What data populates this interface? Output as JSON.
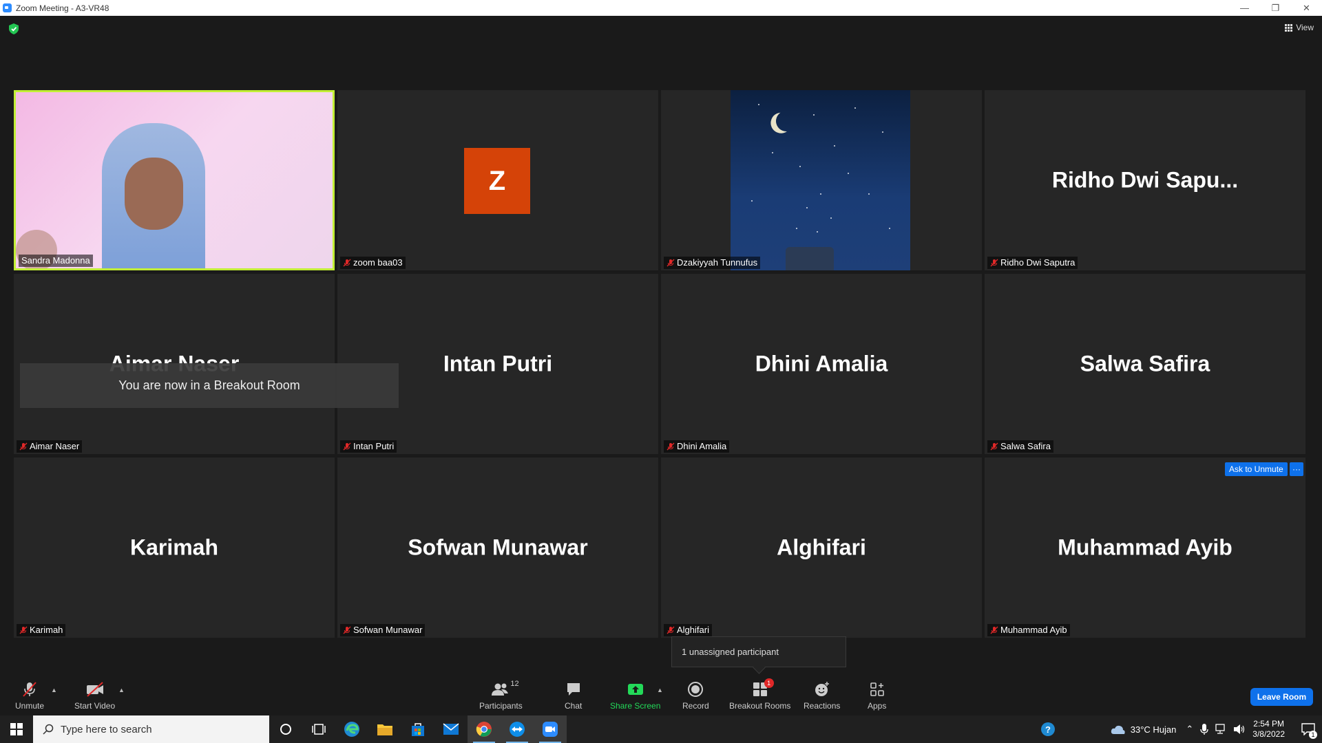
{
  "window": {
    "title": "Zoom Meeting - A3-VR48"
  },
  "top": {
    "view_label": "View"
  },
  "toast": {
    "text": "You are now in a Breakout Room"
  },
  "tiles": [
    {
      "big_name": "",
      "label": "Sandra Madonna",
      "muted": false,
      "type": "video"
    },
    {
      "big_name": "",
      "label": "zoom baa03",
      "muted": true,
      "type": "avatar",
      "avatar_letter": "Z",
      "avatar_color": "#d54308"
    },
    {
      "big_name": "",
      "label": "Dzakiyyah Tunnufus",
      "muted": true,
      "type": "image"
    },
    {
      "big_name": "Ridho Dwi Sapu...",
      "label": "Ridho Dwi Saputra",
      "muted": true,
      "type": "name"
    },
    {
      "big_name": "Aimar Naser",
      "label": "Aimar Naser",
      "muted": true,
      "type": "name"
    },
    {
      "big_name": "Intan Putri",
      "label": "Intan Putri",
      "muted": true,
      "type": "name"
    },
    {
      "big_name": "Dhini Amalia",
      "label": "Dhini Amalia",
      "muted": true,
      "type": "name"
    },
    {
      "big_name": "Salwa Safira",
      "label": "Salwa Safira",
      "muted": true,
      "type": "name"
    },
    {
      "big_name": "Karimah",
      "label": "Karimah",
      "muted": true,
      "type": "name"
    },
    {
      "big_name": "Sofwan Munawar",
      "label": "Sofwan Munawar",
      "muted": true,
      "type": "name"
    },
    {
      "big_name": "Alghifari",
      "label": "Alghifari",
      "muted": true,
      "type": "name"
    },
    {
      "big_name": "Muhammad Ayib",
      "label": "Muhammad Ayib",
      "muted": true,
      "type": "name"
    }
  ],
  "ask_unmute": {
    "label": "Ask to Unmute",
    "more": "···"
  },
  "tooltip": {
    "text": "1 unassigned participant"
  },
  "toolbar": {
    "unmute": "Unmute",
    "start_video": "Start Video",
    "participants": "Participants",
    "participants_count": "12",
    "chat": "Chat",
    "share_screen": "Share Screen",
    "record": "Record",
    "breakout_rooms": "Breakout Rooms",
    "breakout_badge": "1",
    "reactions": "Reactions",
    "apps": "Apps",
    "leave_room": "Leave Room"
  },
  "taskbar": {
    "search_placeholder": "Type here to search",
    "weather": "33°C  Hujan",
    "time": "2:54 PM",
    "date": "3/8/2022",
    "notification_count": "1"
  },
  "colors": {
    "accent_blue": "#0e71eb",
    "active_speaker": "#c2ef36",
    "share_green": "#23d959",
    "mute_red": "#e02828"
  }
}
